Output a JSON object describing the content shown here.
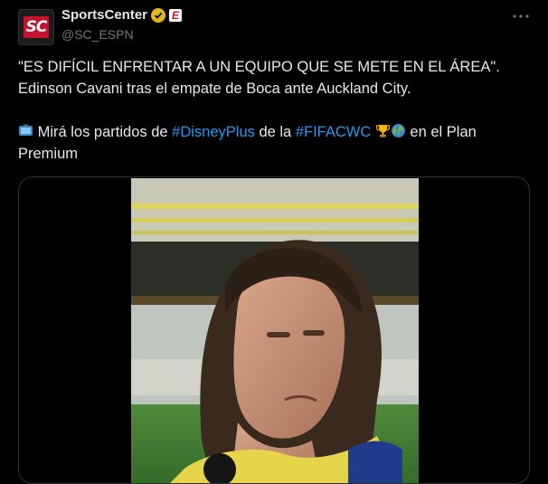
{
  "account": {
    "display_name": "SportsCenter",
    "handle": "@SC_ESPN",
    "avatar_text": "SC",
    "affiliate_badge": "E"
  },
  "tweet": {
    "line1": "\"ES DIFÍCIL ENFRENTAR A UN EQUIPO QUE SE METE EN EL ÁREA\".",
    "line2": "Edinson Cavani tras el empate de Boca ante Auckland City.",
    "promo_part1": " Mirá los partidos de ",
    "hashtag1": "#DisneyPlus",
    "promo_part2": " de la ",
    "hashtag2": "#FIFACWC",
    "promo_part3": " en el Plan Premium"
  },
  "icons": {
    "more": "more-options-icon",
    "verified": "verified-badge-icon",
    "tv": "tv-emoji-icon",
    "trophy": "trophy-emoji-icon",
    "globe": "globe-emoji-icon"
  },
  "colors": {
    "background": "#000000",
    "text": "#e7e9ea",
    "secondary": "#71767b",
    "link": "#1d9bf0",
    "verified": "#e2b719",
    "brand": "#c4122f"
  }
}
